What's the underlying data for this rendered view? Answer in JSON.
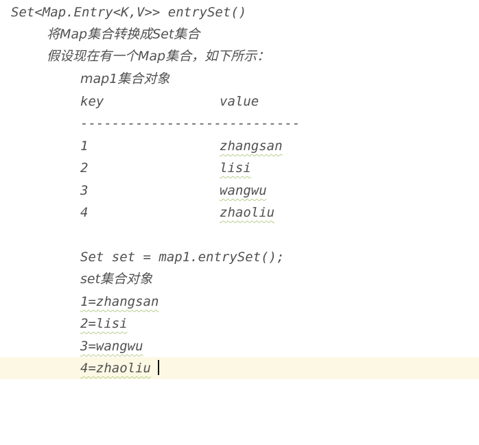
{
  "editor": {
    "lines": [
      "Set<Map.Entry<K,V>> entrySet()",
      "将Map集合转换成Set集合",
      "假设现在有一个Map集合，如下所示：",
      "map1集合对象",
      "key",
      "value",
      "----------------------------",
      "1",
      "zhangsan",
      "2",
      "lisi",
      "3",
      "wangwu",
      "4",
      "zhaoliu",
      "Set set = map1.entrySet();",
      "set集合对象",
      "1=zhangsan",
      "2=lisi",
      "3=wangwu",
      "4=zhaoliu"
    ]
  },
  "colors": {
    "text": "#505050",
    "current_line": "#fdf8e4",
    "spell_squiggle": "#b7cf8e"
  }
}
